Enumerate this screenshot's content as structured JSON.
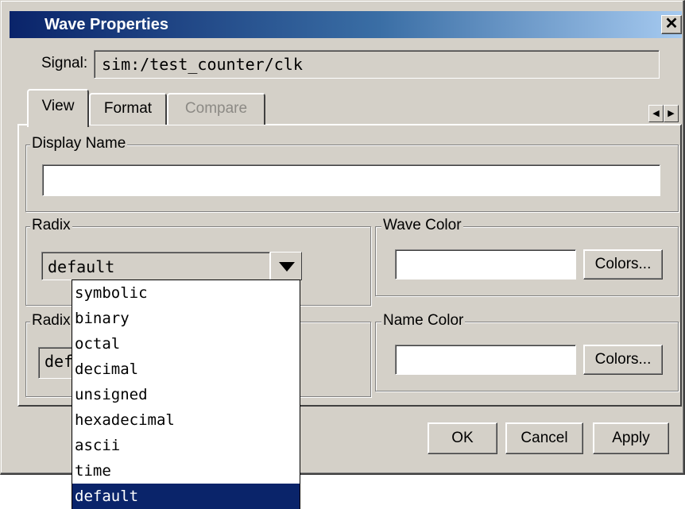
{
  "window": {
    "title": "Wave Properties",
    "close_glyph": "✕"
  },
  "signal": {
    "label": "Signal:",
    "value": "sim:/test_counter/clk"
  },
  "tabs": [
    {
      "label": "View",
      "active": true,
      "enabled": true
    },
    {
      "label": "Format",
      "active": false,
      "enabled": true
    },
    {
      "label": "Compare",
      "active": false,
      "enabled": false
    }
  ],
  "tab_scroll": {
    "left": "◀",
    "right": "▶"
  },
  "display_name": {
    "legend": "Display Name",
    "value": ""
  },
  "radix": {
    "legend": "Radix",
    "selected": "default"
  },
  "radix2": {
    "legend": "Radix",
    "value": "def"
  },
  "wave_color": {
    "legend": "Wave Color",
    "button": "Colors..."
  },
  "name_color": {
    "legend": "Name Color",
    "button": "Colors..."
  },
  "buttons": {
    "ok": "OK",
    "cancel": "Cancel",
    "apply": "Apply"
  },
  "radix_options": [
    "symbolic",
    "binary",
    "octal",
    "decimal",
    "unsigned",
    "hexadecimal",
    "ascii",
    "time",
    "default"
  ],
  "colors": {
    "title_start": "#0a246a",
    "title_end": "#a6caf0",
    "face": "#d4d0c8",
    "selection": "#0a246a"
  }
}
